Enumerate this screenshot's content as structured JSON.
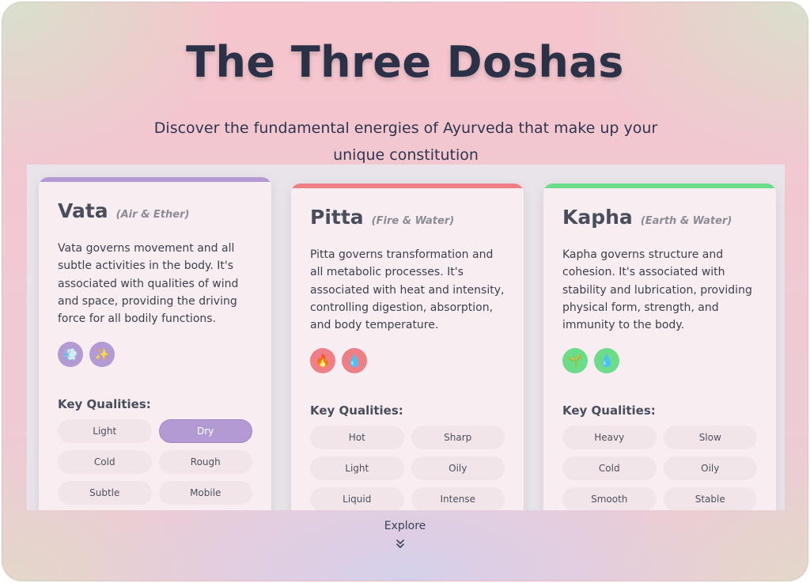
{
  "hero": {
    "title": "The Three Doshas",
    "subtitle": "Discover the fundamental energies of Ayurveda that make up your unique constitution"
  },
  "colors": {
    "vata": "#b39ad3",
    "pitta": "#ee7f87",
    "kapha": "#6bdc8a"
  },
  "doshas": [
    {
      "name": "Vata",
      "elements": "(Air & Ether)",
      "description": "Vata governs movement and all subtle activities in the body. It's associated with qualities of wind and space, providing the driving force for all bodily functions.",
      "icons": [
        {
          "name": "wind-icon",
          "glyph": "💨"
        },
        {
          "name": "sparkles-icon",
          "glyph": "✨"
        }
      ],
      "qualities_label": "Key Qualities:",
      "qualities": [
        "Light",
        "Dry",
        "Cold",
        "Rough",
        "Subtle",
        "Mobile"
      ],
      "selected_quality": "Dry"
    },
    {
      "name": "Pitta",
      "elements": "(Fire & Water)",
      "description": "Pitta governs transformation and all metabolic processes. It's associated with heat and intensity, controlling digestion, absorption, and body temperature.",
      "icons": [
        {
          "name": "fire-icon",
          "glyph": "🔥"
        },
        {
          "name": "water-drop-icon",
          "glyph": "💧"
        }
      ],
      "qualities_label": "Key Qualities:",
      "qualities": [
        "Hot",
        "Sharp",
        "Light",
        "Oily",
        "Liquid",
        "Intense"
      ]
    },
    {
      "name": "Kapha",
      "elements": "(Earth & Water)",
      "description": "Kapha governs structure and cohesion. It's associated with stability and lubrication, providing physical form, strength, and immunity to the body.",
      "icons": [
        {
          "name": "seedling-icon",
          "glyph": "🌱"
        },
        {
          "name": "water-drop-icon",
          "glyph": "💧"
        }
      ],
      "qualities_label": "Key Qualities:",
      "qualities": [
        "Heavy",
        "Slow",
        "Cold",
        "Oily",
        "Smooth",
        "Stable"
      ]
    }
  ],
  "explore": {
    "label": "Explore"
  }
}
